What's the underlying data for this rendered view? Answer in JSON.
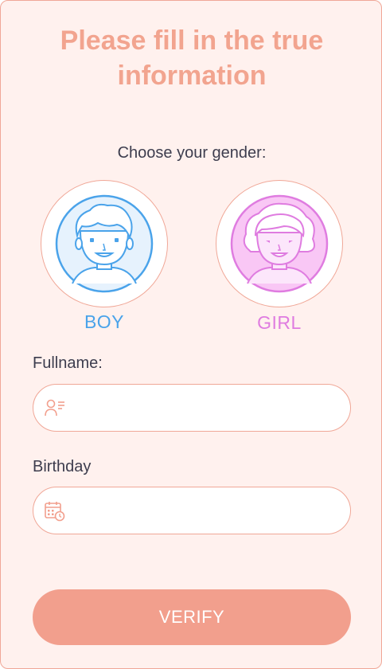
{
  "title": "Please fill in the true information",
  "gender": {
    "prompt": "Choose your gender:",
    "options": [
      {
        "label": "BOY",
        "icon": "boy-avatar-icon",
        "color": "#4aa3ea"
      },
      {
        "label": "GIRL",
        "icon": "girl-avatar-icon",
        "color": "#df7ce0"
      }
    ]
  },
  "fullname": {
    "label": "Fullname:",
    "value": "",
    "placeholder": "",
    "icon": "user-card-icon"
  },
  "birthday": {
    "label": "Birthday",
    "value": "",
    "placeholder": "",
    "icon": "calendar-clock-icon"
  },
  "verify_label": "VERIFY",
  "colors": {
    "accent": "#f29f8d",
    "background": "#fff1ee",
    "border": "#f0a797",
    "text": "#3d3d4e"
  }
}
